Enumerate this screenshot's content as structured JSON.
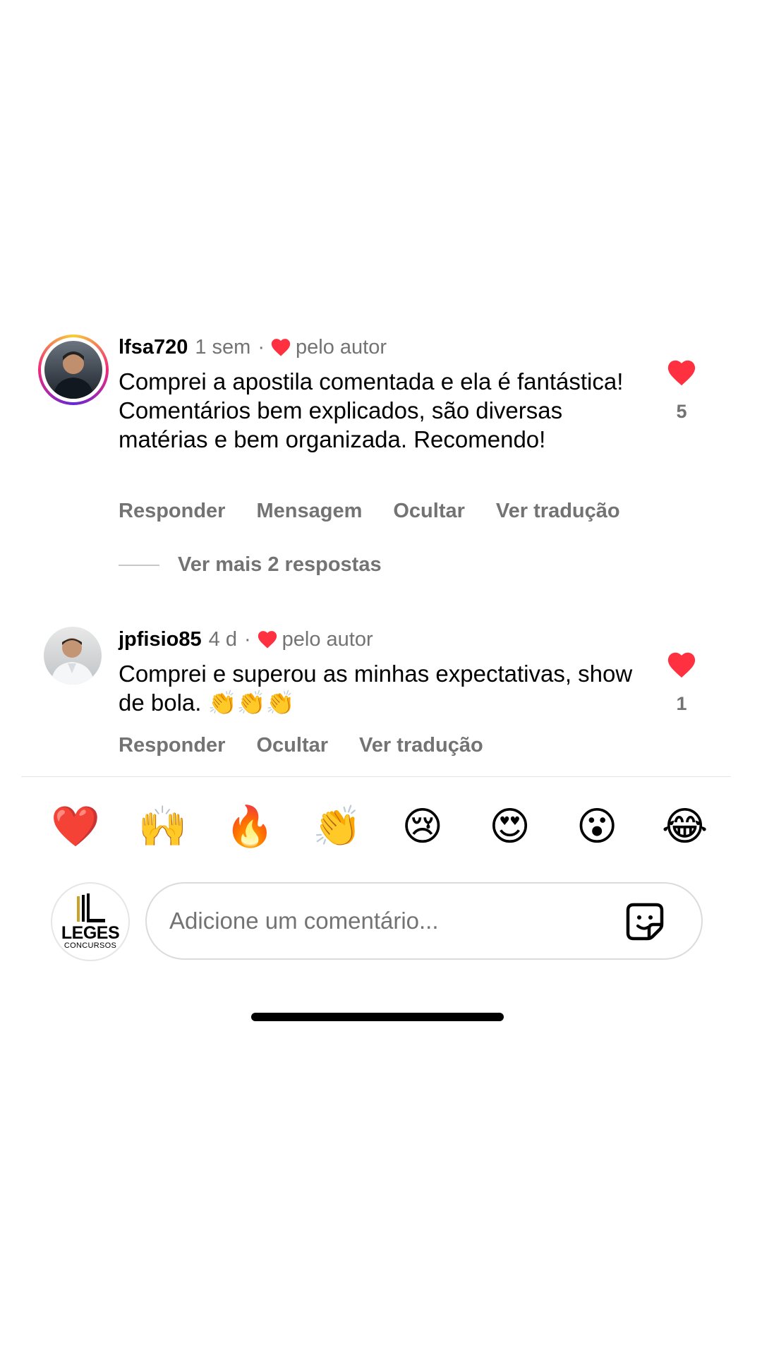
{
  "comments": [
    {
      "username": "lfsa720",
      "time": "1 sem",
      "separator": "·",
      "liked_by": "pelo autor",
      "text": "Comprei a apostila comentada e ela é fantástica! Comentários bem explicados, são diversas matérias e bem organizada. Recomendo!",
      "like_count": "5",
      "actions": [
        "Responder",
        "Mensagem",
        "Ocultar",
        "Ver tradução"
      ],
      "more_replies": "Ver mais 2 respostas"
    },
    {
      "username": "jpfisio85",
      "time": "4 d",
      "separator": "·",
      "liked_by": "pelo autor",
      "text": "Comprei e superou as minhas expectativas, show de bola. 👏👏👏",
      "like_count": "1",
      "actions": [
        "Responder",
        "Ocultar",
        "Ver tradução"
      ]
    }
  ],
  "emoji_bar": [
    "❤️",
    "🙌",
    "🔥",
    "👏",
    "😢",
    "😍",
    "😮",
    "😂"
  ],
  "composer": {
    "placeholder": "Adicione um comentário...",
    "brand_name": "LEGES",
    "brand_sub": "CONCURSOS"
  },
  "colors": {
    "like_red": "#ff3040",
    "secondary_text": "#737373"
  }
}
